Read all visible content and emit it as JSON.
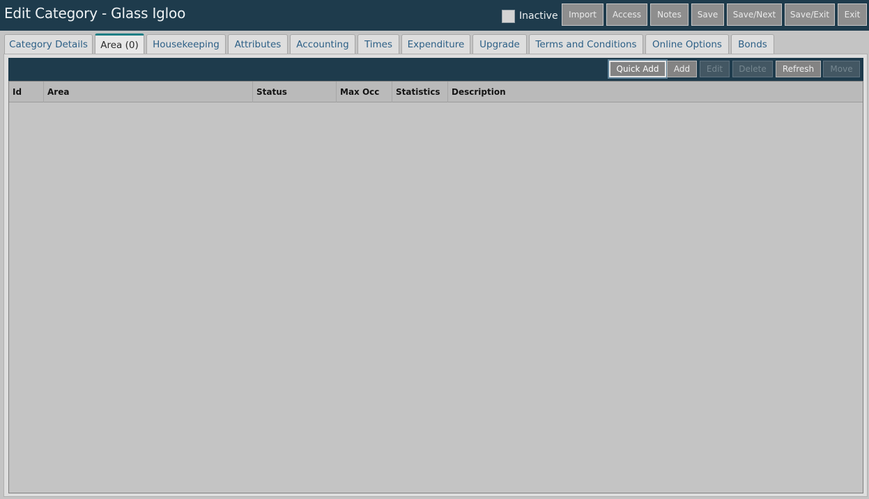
{
  "header": {
    "title": "Edit Category - Glass Igloo",
    "inactive_label": "Inactive",
    "inactive_checked": false,
    "buttons": {
      "import": "Import",
      "access": "Access",
      "notes": "Notes",
      "save": "Save",
      "save_next": "Save/Next",
      "save_exit": "Save/Exit",
      "exit": "Exit"
    }
  },
  "tabs": [
    {
      "label": "Category Details",
      "active": false
    },
    {
      "label": "Area (0)",
      "active": true
    },
    {
      "label": "Housekeeping",
      "active": false
    },
    {
      "label": "Attributes",
      "active": false
    },
    {
      "label": "Accounting",
      "active": false
    },
    {
      "label": "Times",
      "active": false
    },
    {
      "label": "Expenditure",
      "active": false
    },
    {
      "label": "Upgrade",
      "active": false
    },
    {
      "label": "Terms and Conditions",
      "active": false
    },
    {
      "label": "Online Options",
      "active": false
    },
    {
      "label": "Bonds",
      "active": false
    }
  ],
  "toolbar": {
    "quick_add": "Quick Add",
    "add": "Add",
    "edit": "Edit",
    "delete": "Delete",
    "refresh": "Refresh",
    "move": "Move"
  },
  "grid": {
    "columns": [
      "Id",
      "Area",
      "Status",
      "Max Occ",
      "Statistics",
      "Description"
    ],
    "rows": []
  },
  "colors": {
    "header_bg": "#1e3b4c",
    "tab_active_accent": "#1a7e84",
    "tab_text": "#2c5f86",
    "grid_bg": "#c4c4c4"
  }
}
